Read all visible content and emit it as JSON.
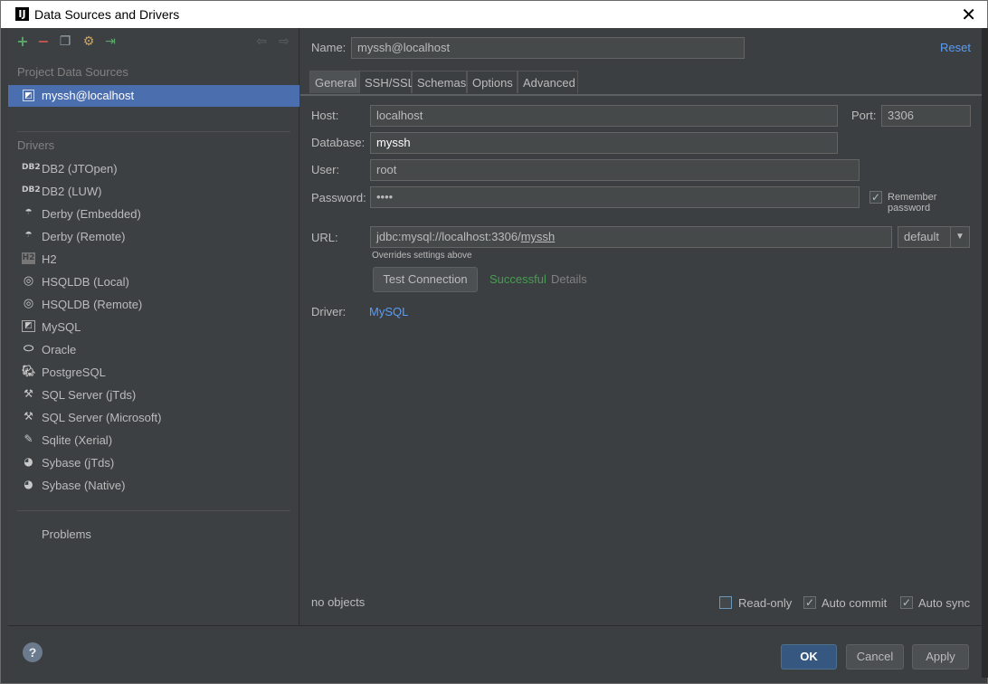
{
  "window": {
    "title": "Data Sources and Drivers",
    "app_icon_text": "IJ"
  },
  "sidebar": {
    "project_sources_label": "Project Data Sources",
    "selected_source": "myssh@localhost",
    "drivers_label": "Drivers",
    "drivers": [
      {
        "label": "DB2 (JTOpen)",
        "icon": "db2-icon"
      },
      {
        "label": "DB2 (LUW)",
        "icon": "db2-icon"
      },
      {
        "label": "Derby (Embedded)",
        "icon": "derby-icon"
      },
      {
        "label": "Derby (Remote)",
        "icon": "derby-icon"
      },
      {
        "label": "H2",
        "icon": "h2-icon"
      },
      {
        "label": "HSQLDB (Local)",
        "icon": "hsqldb-icon"
      },
      {
        "label": "HSQLDB (Remote)",
        "icon": "hsqldb-icon"
      },
      {
        "label": "MySQL",
        "icon": "mysql-icon"
      },
      {
        "label": "Oracle",
        "icon": "oracle-icon"
      },
      {
        "label": "PostgreSQL",
        "icon": "postgresql-icon"
      },
      {
        "label": "SQL Server (jTds)",
        "icon": "sqlserver-icon"
      },
      {
        "label": "SQL Server (Microsoft)",
        "icon": "sqlserver-icon"
      },
      {
        "label": "Sqlite (Xerial)",
        "icon": "sqlite-icon"
      },
      {
        "label": "Sybase (jTds)",
        "icon": "sybase-icon"
      },
      {
        "label": "Sybase (Native)",
        "icon": "sybase-icon"
      }
    ],
    "problems_label": "Problems"
  },
  "main": {
    "name_label": "Name:",
    "name_value": "myssh@localhost",
    "reset_label": "Reset",
    "tabs": [
      "General",
      "SSH/SSL",
      "Schemas",
      "Options",
      "Advanced"
    ],
    "host_label": "Host:",
    "host_value": "localhost",
    "port_label": "Port:",
    "port_value": "3306",
    "database_label": "Database:",
    "database_value": "myssh",
    "user_label": "User:",
    "user_value": "root",
    "password_label": "Password:",
    "password_value": "••••",
    "remember_password_label": "Remember password",
    "url_label": "URL:",
    "url_prefix": "jdbc:mysql://localhost:3306/",
    "url_db": "myssh",
    "url_mode": "default",
    "overrides_hint": "Overrides settings above",
    "test_connection_label": "Test Connection",
    "status_text": "Successful",
    "details_label": "Details",
    "driver_label": "Driver:",
    "driver_value": "MySQL",
    "objects_text": "no objects",
    "readonly_label": "Read-only",
    "autocommit_label": "Auto commit",
    "autosync_label": "Auto sync"
  },
  "footer": {
    "help_label": "?",
    "ok_label": "OK",
    "cancel_label": "Cancel",
    "apply_label": "Apply"
  },
  "colors": {
    "background": "#3c3f41",
    "selection": "#4b6eaf",
    "link": "#589df6",
    "success": "#499c54",
    "primary_button": "#365880"
  }
}
